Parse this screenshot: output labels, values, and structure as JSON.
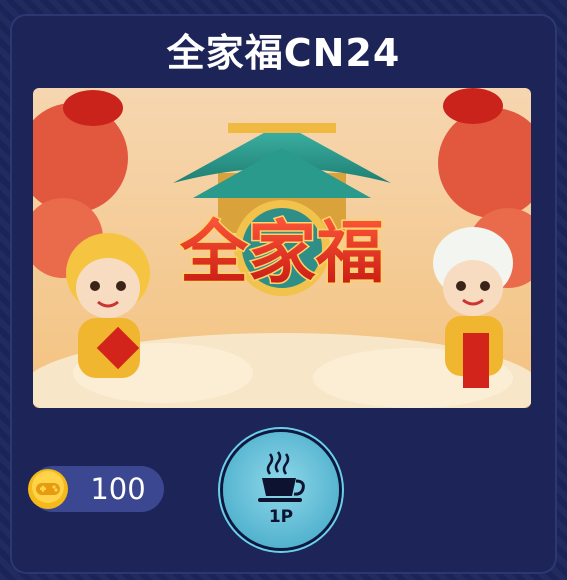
{
  "game": {
    "title": "全家福CN24",
    "banner_text": "全家福",
    "coins": "100",
    "player_mode": "1P"
  },
  "colors": {
    "background": "#16204f",
    "card": "#1d2458",
    "coin_pill": "#3b4790",
    "button_teal": "#6ad0ea"
  },
  "icons": {
    "coin": "gamepad-coin-icon",
    "player": "coffee-cup-icon"
  }
}
